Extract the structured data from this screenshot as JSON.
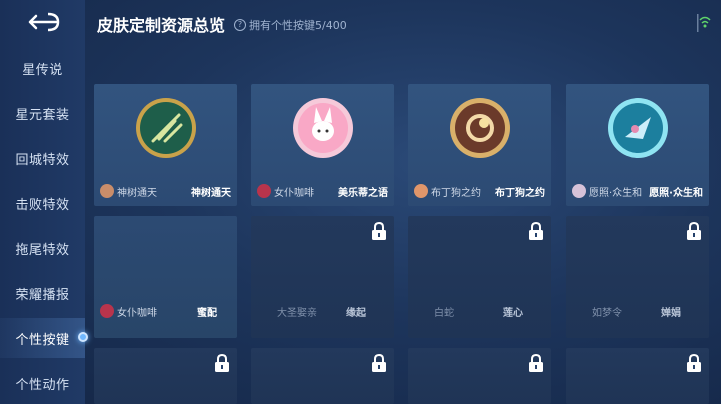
{
  "header": {
    "title": "皮肤定制资源总览",
    "subtitle": "拥有个性按键5/400"
  },
  "sidebar": {
    "items": [
      {
        "label": "星传说"
      },
      {
        "label": "星元套装"
      },
      {
        "label": "回城特效"
      },
      {
        "label": "击败特效"
      },
      {
        "label": "拖尾特效"
      },
      {
        "label": "荣耀播报"
      },
      {
        "label": "个性按键",
        "active": true
      },
      {
        "label": "个性动作"
      }
    ]
  },
  "cards": [
    {
      "owner": "神树通天",
      "name": "神树通天",
      "emblem_color": "#5fa87a"
    },
    {
      "owner": "女仆咖啡",
      "name": "美乐蒂之语",
      "emblem_color": "#f2a7c4"
    },
    {
      "owner": "布丁狗之约",
      "name": "布丁狗之约",
      "emblem_color": "#c89b5a"
    },
    {
      "owner": "愿照·众生和",
      "name": "愿照·众生和",
      "emblem_color": "#47b6d0"
    },
    {
      "owner": "女仆咖啡",
      "name": "蜜配"
    },
    {
      "owner": "大圣娶亲",
      "name": "缘起"
    },
    {
      "owner": "白蛇",
      "name": "莲心"
    },
    {
      "owner": "如梦令",
      "name": "婵娟"
    }
  ],
  "colors": {
    "accent": "#6fb8ff",
    "background": "#1d355c"
  },
  "icons": {
    "back": "back-arrow-icon",
    "lock": "lock-icon",
    "help": "question-icon",
    "wifi": "wifi-icon"
  }
}
